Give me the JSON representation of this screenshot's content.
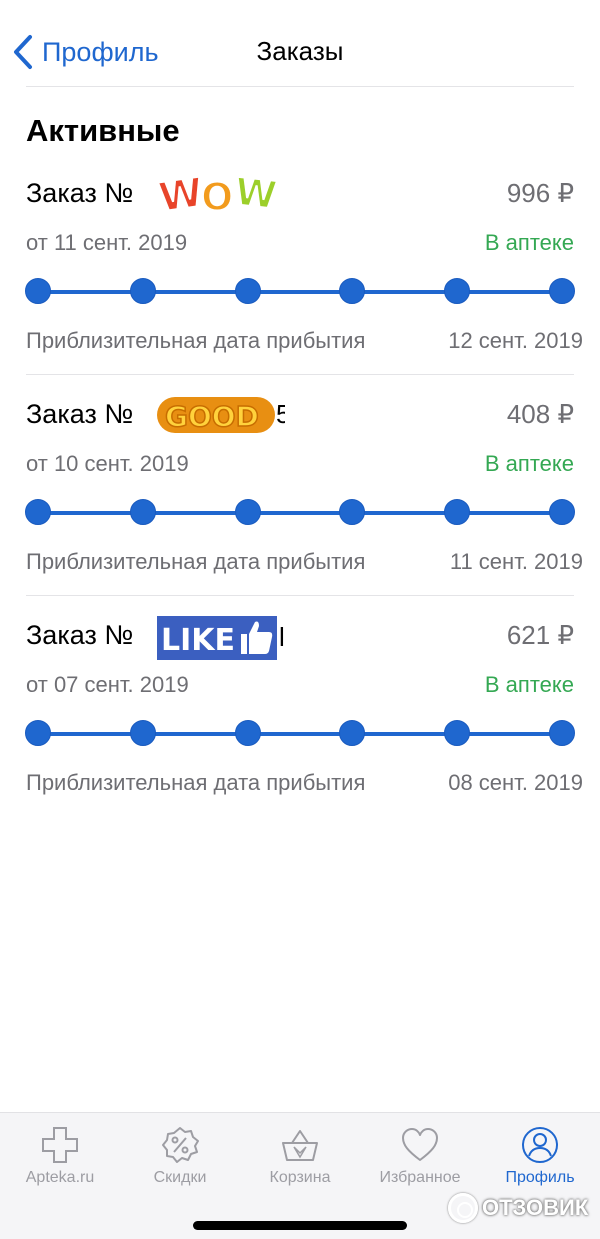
{
  "nav": {
    "back_label": "Профиль",
    "title": "Заказы"
  },
  "section_title": "Активные",
  "orders": [
    {
      "title": "Заказ №",
      "price": "996 ₽",
      "date": "от 11 сент. 2019",
      "status": "В аптеке",
      "eta_label": "Приблизительная дата прибытия",
      "eta_date": "12 сент. 2019",
      "progress_steps": 6,
      "sticker": "WOW"
    },
    {
      "title": "Заказ №",
      "price": "408 ₽",
      "date": "от 10 сент. 2019",
      "status": "В аптеке",
      "eta_label": "Приблизительная дата прибытия",
      "eta_date": "11 сент. 2019",
      "progress_steps": 6,
      "sticker": "GOOD"
    },
    {
      "title": "Заказ №",
      "price": "621 ₽",
      "date": "от 07 сент. 2019",
      "status": "В аптеке",
      "eta_label": "Приблизительная дата прибытия",
      "eta_date": "08 сент. 2019",
      "progress_steps": 6,
      "sticker": "LIKE"
    }
  ],
  "tabbar": {
    "items": [
      {
        "label": "Apteka.ru",
        "icon": "cross-icon",
        "active": false
      },
      {
        "label": "Скидки",
        "icon": "discount-badge-icon",
        "active": false
      },
      {
        "label": "Корзина",
        "icon": "basket-icon",
        "active": false
      },
      {
        "label": "Избранное",
        "icon": "heart-icon",
        "active": false
      },
      {
        "label": "Профиль",
        "icon": "profile-icon",
        "active": true
      }
    ]
  },
  "watermark": "ОТЗОВИК",
  "colors": {
    "accent": "#1f67cf",
    "status_green": "#34a853",
    "secondary_text": "#6e6e73",
    "tab_inactive": "#9d9da3"
  }
}
